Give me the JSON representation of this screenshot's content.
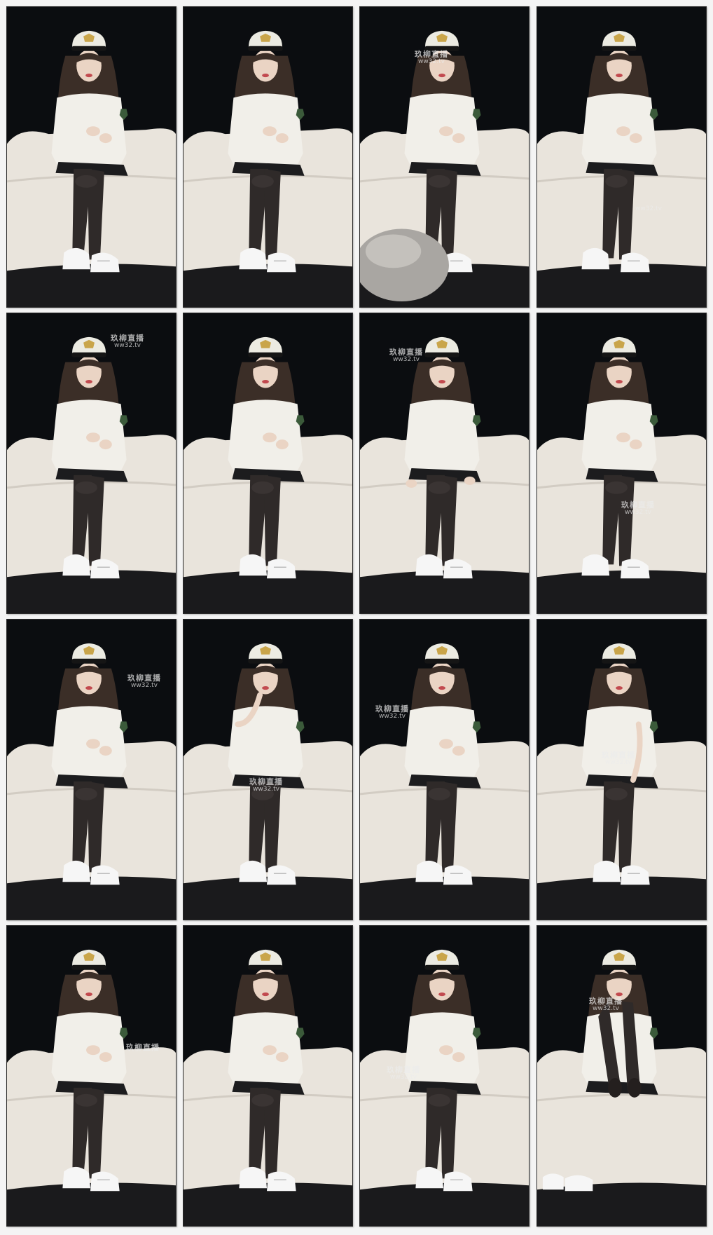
{
  "contact_sheet": {
    "columns": 4,
    "rows": 4,
    "frames": [
      {
        "variant": "talking",
        "watermark": {
          "line1": "",
          "line2": ""
        }
      },
      {
        "variant": "talking",
        "watermark": {
          "line1": "",
          "line2": ""
        }
      },
      {
        "variant": "cat",
        "watermark": {
          "line1": "玖柳直播",
          "line2": "ww32.tv"
        }
      },
      {
        "variant": "leg-out",
        "watermark": {
          "line1": "",
          "line2": "ww32.tv"
        }
      },
      {
        "variant": "talking",
        "watermark": {
          "line1": "玖柳直播",
          "line2": "ww32.tv"
        }
      },
      {
        "variant": "hands",
        "watermark": {
          "line1": "",
          "line2": ""
        }
      },
      {
        "variant": "hands-low",
        "watermark": {
          "line1": "玖柳直播",
          "line2": "ww32.tv"
        }
      },
      {
        "variant": "leg-out",
        "watermark": {
          "line1": "玖柳直播",
          "line2": "ww32.tv"
        }
      },
      {
        "variant": "talking",
        "watermark": {
          "line1": "玖柳直播",
          "line2": "ww32.tv"
        }
      },
      {
        "variant": "chin",
        "watermark": {
          "line1": "玖柳直播",
          "line2": "ww32.tv"
        }
      },
      {
        "variant": "hands",
        "watermark": {
          "line1": "玖柳直播",
          "line2": "ww32.tv"
        }
      },
      {
        "variant": "finger",
        "watermark": {
          "line1": "玖柳直播",
          "line2": "ww32.tv"
        }
      },
      {
        "variant": "hands",
        "watermark": {
          "line1": "玖柳直播",
          "line2": ""
        }
      },
      {
        "variant": "hands",
        "watermark": {
          "line1": "",
          "line2": ""
        }
      },
      {
        "variant": "hands",
        "watermark": {
          "line1": "玖柳直播",
          "line2": "ww32.tv"
        }
      },
      {
        "variant": "legs-up",
        "watermark": {
          "line1": "玖柳直播",
          "line2": "ww32.tv"
        }
      }
    ]
  },
  "colors": {
    "sheet_background": "#f4f4f4",
    "studio_background": "#0b0d10",
    "sofa": "#e9e4dc",
    "rug": "#1a1a1c",
    "shirt": "#f1efe9",
    "stockings": "#2f2a29",
    "hair": "#3b2e27",
    "skin": "#ead4c4",
    "sneakers": "#f6f6f6",
    "cap": "#ecebe2",
    "cap_badge": "#3b5a3a"
  }
}
